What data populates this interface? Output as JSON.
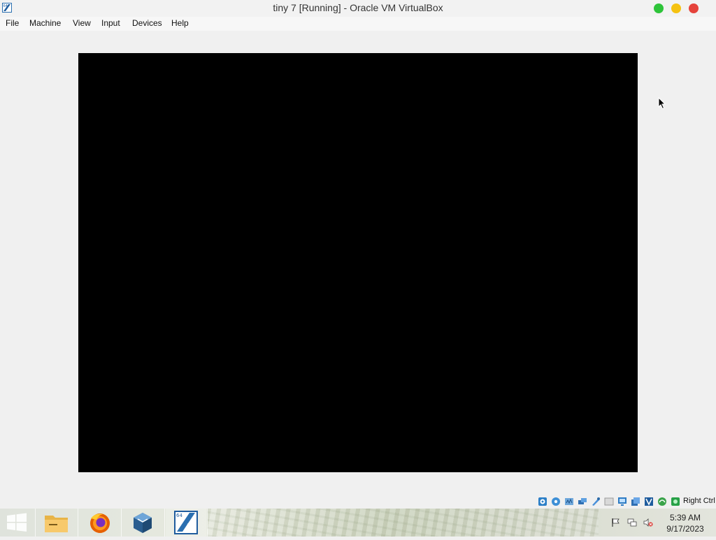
{
  "window": {
    "title": "tiny 7 [Running] - Oracle VM VirtualBox"
  },
  "menubar": {
    "items": [
      "File",
      "Machine",
      "View",
      "Input",
      "Devices",
      "Help"
    ]
  },
  "statusbar": {
    "icons": [
      "hard-disk-icon",
      "optical-drive-icon",
      "audio-icon",
      "network-icon",
      "usb-icon",
      "shared-folders-icon",
      "display-icon",
      "recording-icon",
      "virtualization-icon",
      "cpu-icon",
      "mouse-integration-icon",
      "keyboard-icon"
    ],
    "host_key": "Right Ctrl"
  },
  "taskbar": {
    "apps": [
      "start-button",
      "file-explorer",
      "firefox",
      "virtualbox",
      "tiny7-vm"
    ],
    "tray_icons": [
      "flag-icon",
      "network-icon",
      "volume-muted-icon"
    ],
    "clock": {
      "time": "5:39 AM",
      "date": "9/17/2023"
    }
  },
  "colors": {
    "vm_screen": "#000000",
    "window_bg": "#f0f0f0"
  }
}
